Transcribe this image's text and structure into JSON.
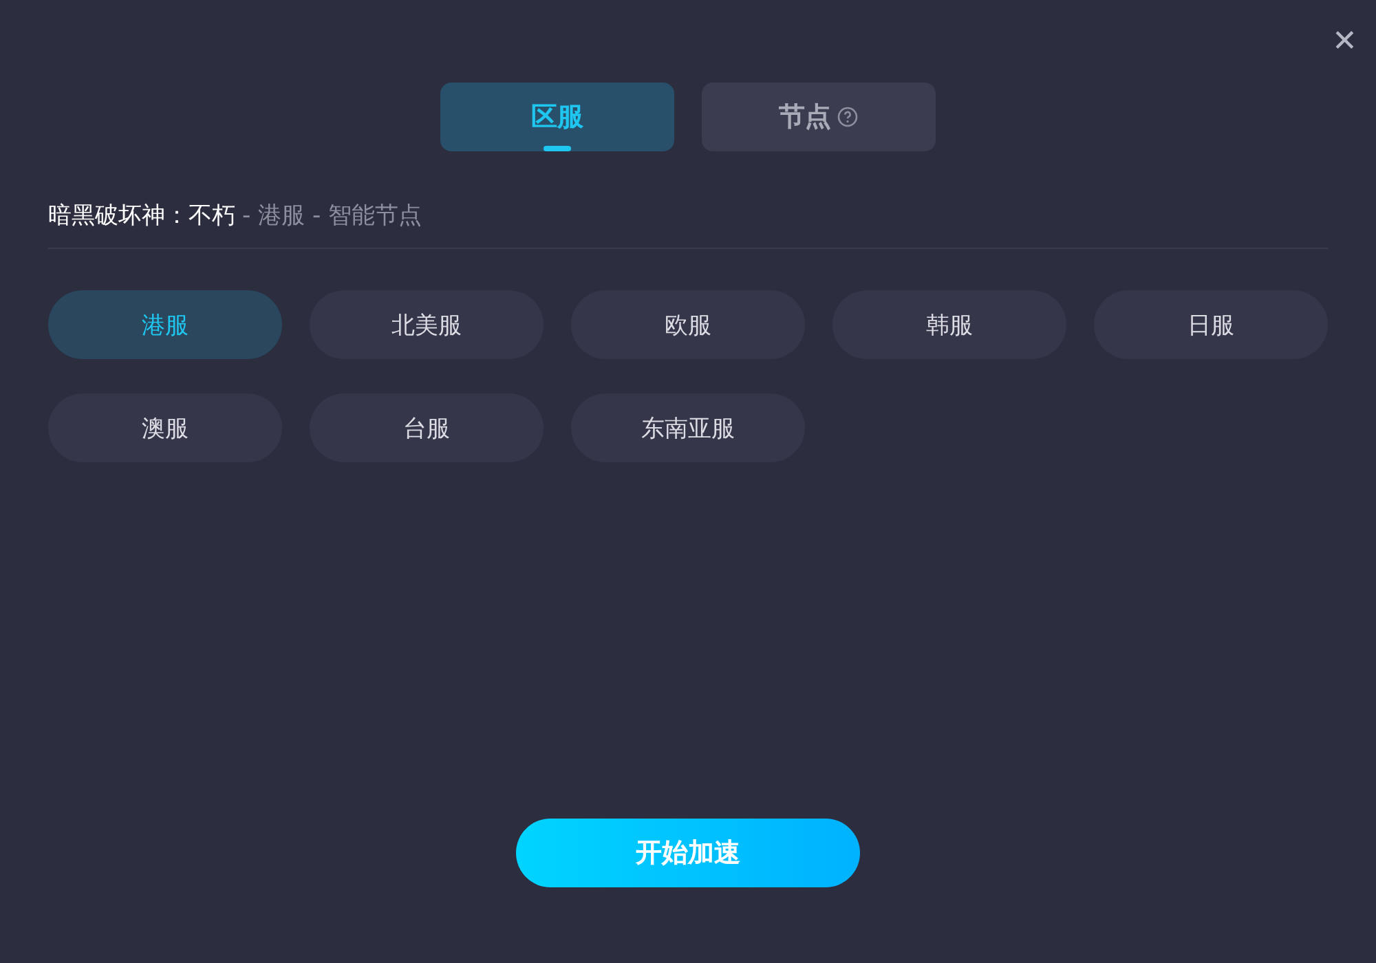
{
  "close": {
    "label": "✕"
  },
  "tabs": [
    {
      "label": "区服",
      "selected": true,
      "help": false
    },
    {
      "label": "节点",
      "selected": false,
      "help": true
    }
  ],
  "breadcrumb": {
    "game": "暗黑破坏神：不朽",
    "path": "- 港服 - 智能节点"
  },
  "regions": [
    {
      "label": "港服",
      "selected": true
    },
    {
      "label": "北美服",
      "selected": false
    },
    {
      "label": "欧服",
      "selected": false
    },
    {
      "label": "韩服",
      "selected": false
    },
    {
      "label": "日服",
      "selected": false
    },
    {
      "label": "澳服",
      "selected": false
    },
    {
      "label": "台服",
      "selected": false
    },
    {
      "label": "东南亚服",
      "selected": false
    }
  ],
  "start_button": {
    "label": "开始加速"
  }
}
